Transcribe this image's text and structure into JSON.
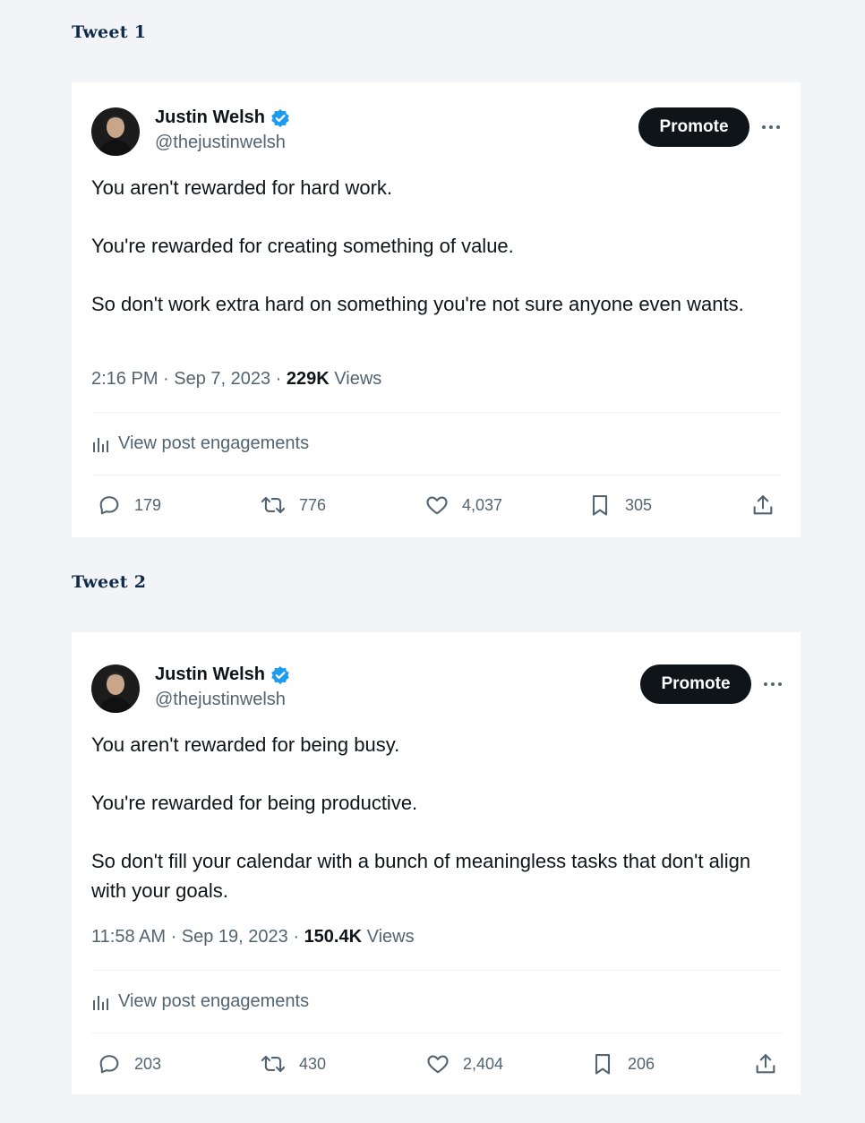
{
  "tweets": [
    {
      "section_label": "Tweet 1",
      "author": {
        "name": "Justin Welsh",
        "handle": "@thejustinwelsh"
      },
      "promote_label": "Promote",
      "paragraphs": [
        "You aren't rewarded for hard work.",
        "You're rewarded for creating something of value.",
        "So don't work extra hard on something you're not sure anyone even wants."
      ],
      "timestamp": "2:16 PM · Sep 7, 2023 · ",
      "views_count": "229K",
      "views_label": " Views",
      "engagements_label": "View post engagements",
      "stats": {
        "replies": "179",
        "reposts": "776",
        "likes": "4,037",
        "bookmarks": "305"
      }
    },
    {
      "section_label": "Tweet 2",
      "author": {
        "name": "Justin Welsh",
        "handle": "@thejustinwelsh"
      },
      "promote_label": "Promote",
      "paragraphs": [
        "You aren't rewarded for being busy.",
        "You're rewarded for being productive.",
        "So don't fill your calendar with a bunch of meaningless tasks that don't align with your goals."
      ],
      "timestamp": "11:58 AM · Sep 19, 2023 · ",
      "views_count": "150.4K",
      "views_label": " Views",
      "engagements_label": "View post engagements",
      "stats": {
        "replies": "203",
        "reposts": "430",
        "likes": "2,404",
        "bookmarks": "206"
      }
    }
  ],
  "colors": {
    "page_bg": "#f3f4f8",
    "card_bg": "#ffffff",
    "primary_text": "#0f1419",
    "secondary_text": "#536471",
    "verified_blue": "#1d9bf0",
    "section_title": "#0f2a4a",
    "promote_bg": "#0f1419"
  },
  "icons": [
    "verified-badge-icon",
    "more-dots-icon",
    "bar-chart-icon",
    "reply-icon",
    "repost-icon",
    "like-icon",
    "bookmark-icon",
    "share-icon"
  ]
}
